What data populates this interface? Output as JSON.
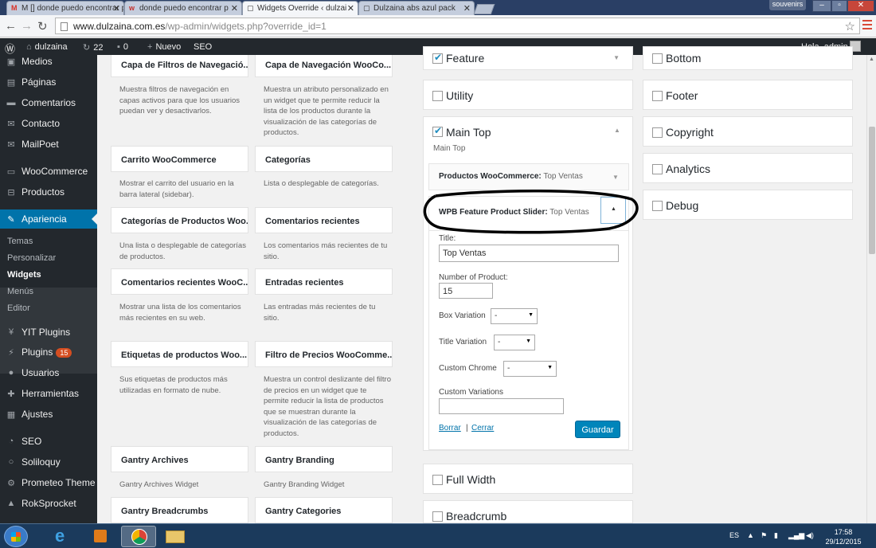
{
  "browser": {
    "tabs": [
      {
        "label": "M  [] donde puedo encontrar p",
        "fav": "M",
        "color": "#d93025"
      },
      {
        "label": "donde puedo encontrar p",
        "fav": "w",
        "color": "#c4302b"
      },
      {
        "label": "Widgets Override ‹ dulzai",
        "fav": "▢",
        "color": "#555"
      },
      {
        "label": "Dulzaina abs azul pack",
        "fav": "▢",
        "color": "#555"
      }
    ],
    "user_button": "souvenirs",
    "url_host": "www.dulzaina.com.es",
    "url_path": "/wp-admin/widgets.php?override_id=1"
  },
  "adminbar": {
    "site": "dulzaina",
    "updates": "22",
    "comments": "0",
    "new": "Nuevo",
    "seo": "SEO",
    "greeting": "Hola, admin"
  },
  "sidebar": {
    "items": [
      {
        "label": "Medios",
        "icon": "media-icon"
      },
      {
        "label": "Páginas",
        "icon": "pages-icon"
      },
      {
        "label": "Comentarios",
        "icon": "comments-icon"
      },
      {
        "label": "Contacto",
        "icon": "mail-icon"
      },
      {
        "label": "MailPoet",
        "icon": "mail-icon"
      },
      {
        "label": "WooCommerce",
        "icon": "woo-icon"
      },
      {
        "label": "Productos",
        "icon": "cart-icon"
      },
      {
        "label": "Apariencia",
        "icon": "brush-icon"
      }
    ],
    "submenu": [
      "Temas",
      "Personalizar",
      "Widgets",
      "Menús",
      "Editor"
    ],
    "items2": [
      {
        "label": "YIT Plugins",
        "icon": "plugin-icon"
      },
      {
        "label": "Plugins",
        "icon": "plugin-icon",
        "badge": "15"
      },
      {
        "label": "Usuarios",
        "icon": "user-icon"
      },
      {
        "label": "Herramientas",
        "icon": "wrench-icon"
      },
      {
        "label": "Ajustes",
        "icon": "settings-icon"
      },
      {
        "label": "SEO",
        "icon": "seo-icon"
      },
      {
        "label": "Soliloquy",
        "icon": "slider-icon"
      },
      {
        "label": "Prometeo Theme",
        "icon": "gear-icon"
      },
      {
        "label": "RokSprocket",
        "icon": "rocket-icon"
      }
    ]
  },
  "available_widgets": [
    {
      "title": "Capa de Filtros de Navegació...",
      "desc": "Muestra filtros de navegación en capas activos para que los usuarios puedan ver y desactivarlos."
    },
    {
      "title": "Capa de Navegación WooCo...",
      "desc": "Muestra un atributo personalizado en un widget que te permite reducir la lista de los productos durante la visualización de las categorías de productos."
    },
    {
      "title": "Carrito WooCommerce",
      "desc": "Mostrar el carrito del usuario en la barra lateral (sidebar)."
    },
    {
      "title": "Categorías",
      "desc": "Lista o desplegable de categorías."
    },
    {
      "title": "Categorías de Productos Woo...",
      "desc": "Una lista o desplegable de categorías de productos."
    },
    {
      "title": "Comentarios recientes",
      "desc": "Los comentarios más recientes de tu sitio."
    },
    {
      "title": "Comentarios recientes WooC...",
      "desc": "Mostrar una lista de los comentarios más recientes en su web."
    },
    {
      "title": "Entradas recientes",
      "desc": "Las entradas más recientes de tu sitio."
    },
    {
      "title": "Etiquetas de productos Woo...",
      "desc": "Sus etiquetas de productos más utilizadas en formato de nube."
    },
    {
      "title": "Filtro de Precios WooComme...",
      "desc": "Muestra un control deslizante del filtro de precios en un widget que te permite reducir la lista de productos que se muestran durante la visualización de las categorías de productos."
    },
    {
      "title": "Gantry Archives",
      "desc": "Gantry Archives Widget"
    },
    {
      "title": "Gantry Branding",
      "desc": "Gantry Branding Widget"
    },
    {
      "title": "Gantry Breadcrumbs",
      "desc": ""
    },
    {
      "title": "Gantry Categories",
      "desc": ""
    }
  ],
  "sidebars_left": [
    {
      "name": "Feature",
      "checked": true
    },
    {
      "name": "Utility",
      "checked": false
    }
  ],
  "sidebars_left_bottom": [
    {
      "name": "Full Width",
      "checked": false
    },
    {
      "name": "Breadcrumb",
      "checked": false
    }
  ],
  "sidebars_right": [
    {
      "name": "Bottom",
      "checked": false
    },
    {
      "name": "Footer",
      "checked": false
    },
    {
      "name": "Copyright",
      "checked": false
    },
    {
      "name": "Analytics",
      "checked": false
    },
    {
      "name": "Debug",
      "checked": false
    }
  ],
  "main_top": {
    "name": "Main Top",
    "checked": true,
    "desc": "Main Top",
    "widget1_name": "Productos WooCommerce:",
    "widget1_title": "Top Ventas",
    "widget2_name": "WPB Feature Product Slider:",
    "widget2_title": "Top Ventas",
    "form": {
      "title_label": "Title:",
      "title_value": "Top Ventas",
      "number_label": "Number of Product:",
      "number_value": "15",
      "box_label": "Box Variation",
      "box_value": "-",
      "title_var_label": "Title Variation",
      "title_var_value": "-",
      "chrome_label": "Custom Chrome",
      "chrome_value": "-",
      "variations_label": "Custom Variations",
      "variations_value": "",
      "delete": "Borrar",
      "sep": "|",
      "close": "Cerrar",
      "save": "Guardar"
    }
  },
  "taskbar": {
    "lang": "ES",
    "time": "17:58",
    "date": "29/12/2015"
  }
}
